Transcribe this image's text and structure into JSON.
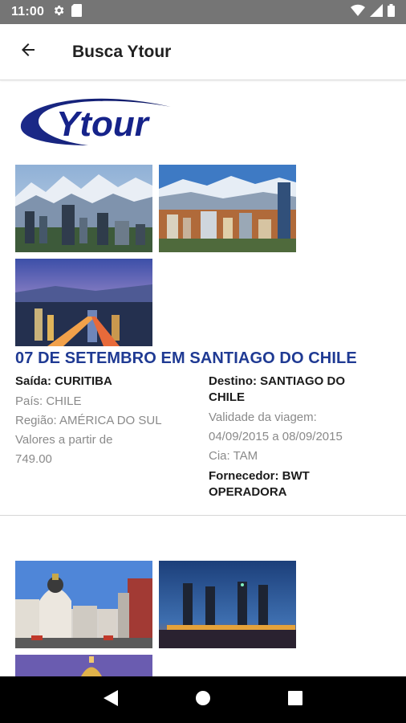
{
  "status_bar": {
    "time": "11:00",
    "icons": [
      "gear-icon",
      "sd-card-icon",
      "wifi-icon",
      "signal-icon",
      "battery-icon"
    ]
  },
  "app_bar": {
    "title": "Busca Ytour",
    "back_icon": "arrow-back-icon"
  },
  "brand": {
    "logo_text": "Ytour",
    "colors": {
      "logo_blue": "#1a2a8c",
      "title_blue": "#1f3a93"
    }
  },
  "listings": [
    {
      "title": "07 DE SETEMBRO EM SANTIAGO DO CHILE",
      "saida": "Saída: CURITIBA",
      "pais": "País: CHILE",
      "regiao": "Região: AMÉRICA DO SUL",
      "valores_label": "Valores a partir de",
      "valores": "749.00",
      "destino_line1": "Destino: SANTIAGO DO",
      "destino_line2": "CHILE",
      "validade_label": "Validade da viagem:",
      "validade": "04/09/2015 a 08/09/2015",
      "cia": "Cia: TAM",
      "fornecedor_line1": "Fornecedor: BWT",
      "fornecedor_line2": "OPERADORA",
      "photos": [
        "santiago-mountains-photo",
        "santiago-skyline-photo",
        "santiago-night-photo"
      ]
    },
    {
      "photos": [
        "madrid-building-photo",
        "madrid-towers-night-photo",
        "purple-dome-photo"
      ]
    }
  ],
  "nav_bar": {
    "icons": [
      "back-triangle-icon",
      "home-circle-icon",
      "recents-square-icon"
    ]
  }
}
